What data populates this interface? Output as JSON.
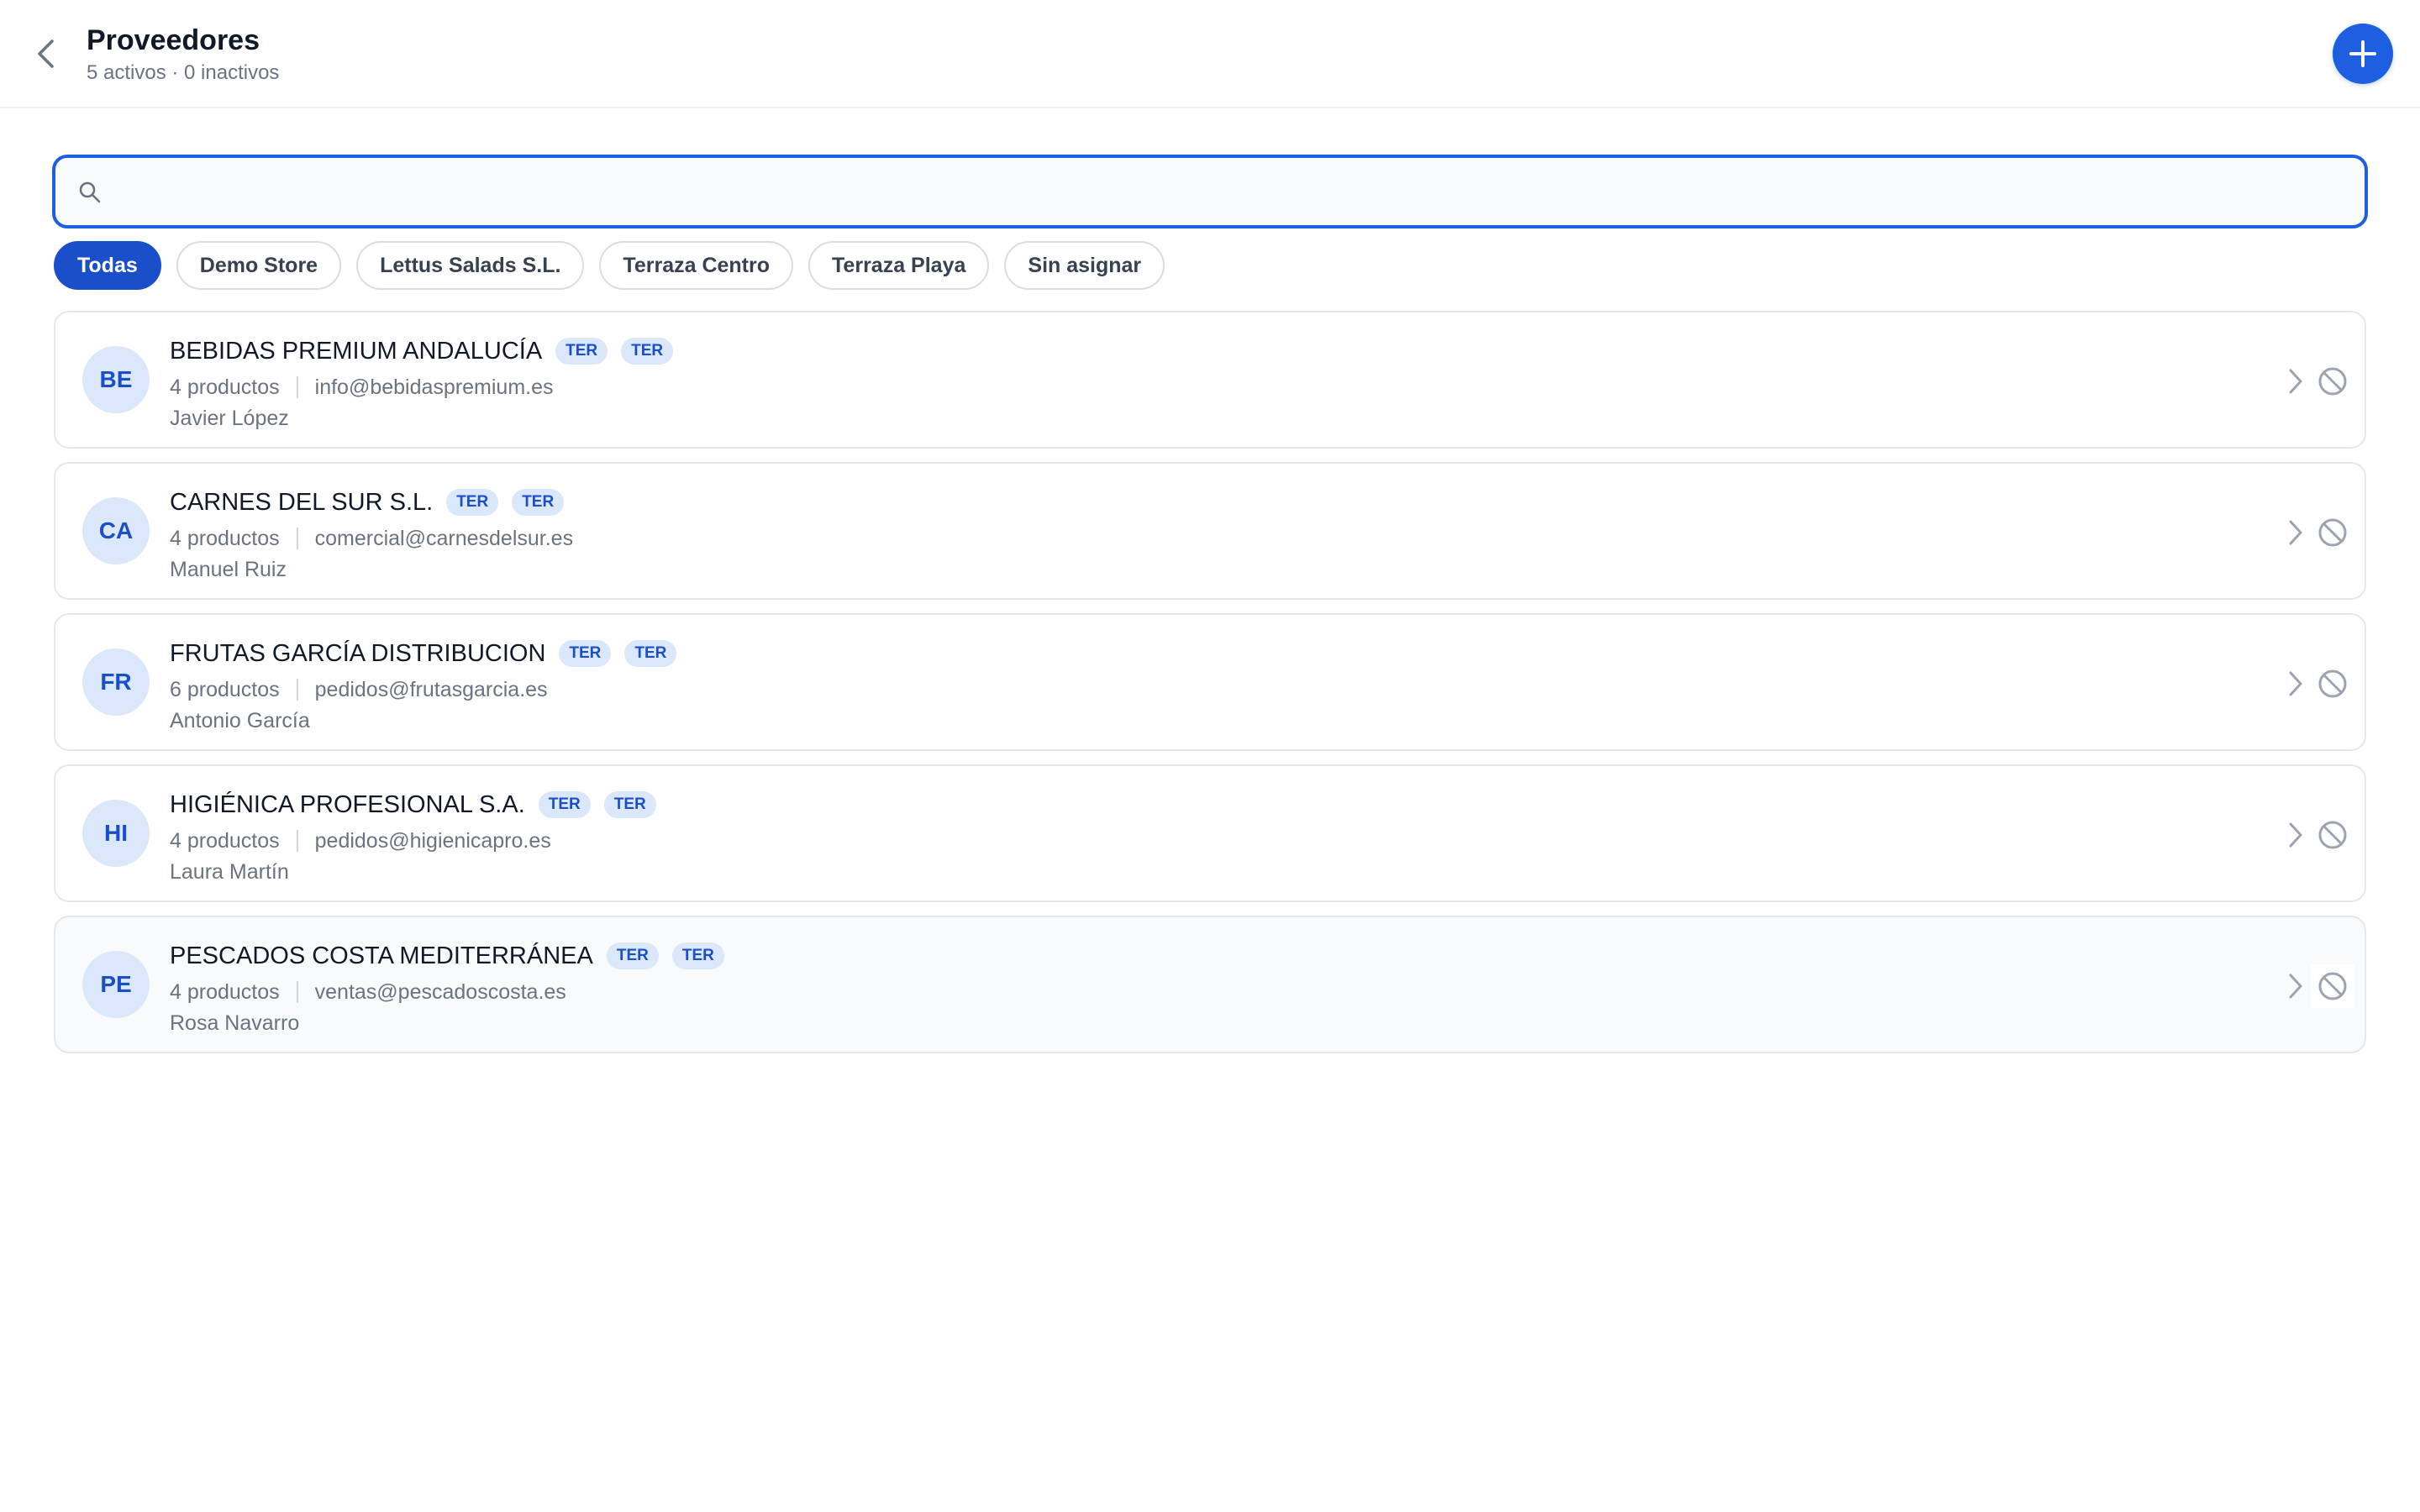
{
  "header": {
    "title": "Proveedores",
    "subtitle": "5 activos · 0 inactivos"
  },
  "search": {
    "placeholder": "",
    "value": ""
  },
  "filters": [
    {
      "label": "Todas",
      "active": true
    },
    {
      "label": "Demo Store",
      "active": false
    },
    {
      "label": "Lettus Salads S.L.",
      "active": false
    },
    {
      "label": "Terraza Centro",
      "active": false
    },
    {
      "label": "Terraza Playa",
      "active": false
    },
    {
      "label": "Sin asignar",
      "active": false
    }
  ],
  "suppliers": [
    {
      "initials": "BE",
      "name": "BEBIDAS PREMIUM ANDALUCÍA",
      "badges": [
        "TER",
        "TER"
      ],
      "products": "4 productos",
      "email": "info@bebidaspremium.es",
      "contact": "Javier López"
    },
    {
      "initials": "CA",
      "name": "CARNES DEL SUR S.L.",
      "badges": [
        "TER",
        "TER"
      ],
      "products": "4 productos",
      "email": "comercial@carnesdelsur.es",
      "contact": "Manuel Ruiz"
    },
    {
      "initials": "FR",
      "name": "FRUTAS GARCÍA DISTRIBUCION",
      "badges": [
        "TER",
        "TER"
      ],
      "products": "6 productos",
      "email": "pedidos@frutasgarcia.es",
      "contact": "Antonio García"
    },
    {
      "initials": "HI",
      "name": "HIGIÉNICA PROFESIONAL S.A.",
      "badges": [
        "TER",
        "TER"
      ],
      "products": "4 productos",
      "email": "pedidos@higienicapro.es",
      "contact": "Laura Martín"
    },
    {
      "initials": "PE",
      "name": "PESCADOS COSTA MEDITERRÁNEA",
      "badges": [
        "TER",
        "TER"
      ],
      "products": "4 productos",
      "email": "ventas@pescadoscosta.es",
      "contact": "Rosa Navarro"
    }
  ],
  "icons": {
    "back": "chevron-left-icon",
    "add": "plus-icon",
    "search": "search-icon",
    "open": "chevron-right-icon",
    "disable": "ban-icon"
  },
  "colors": {
    "accent": "#1d5fe0",
    "chip_active": "#1a4fc9",
    "avatar_bg": "#dbe8fb",
    "avatar_text": "#1a4fc9"
  }
}
